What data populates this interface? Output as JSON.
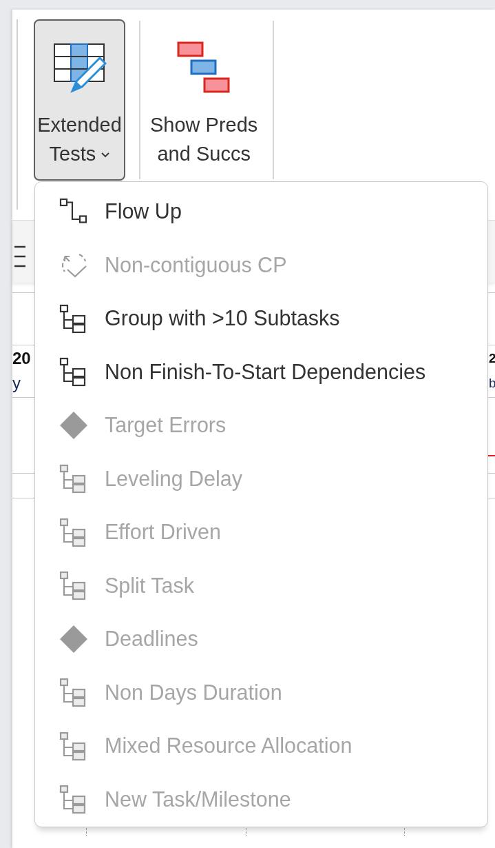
{
  "ribbon": {
    "buttons": [
      {
        "kind": "table-edit",
        "label_lines": [
          "Extended",
          "Tests"
        ],
        "dropdown": true,
        "selected": true
      },
      {
        "kind": "gantt",
        "label_lines": [
          "Show Preds",
          "and Succs"
        ],
        "dropdown": false,
        "selected": false
      }
    ]
  },
  "background": {
    "left_cells": [
      "20",
      "y"
    ],
    "right_cells": [
      "2",
      "b"
    ]
  },
  "menu": {
    "items": [
      {
        "label": "Flow Up",
        "kind": "flow",
        "disabled": false
      },
      {
        "label": "Non-contiguous CP",
        "kind": "dashed-check",
        "disabled": true
      },
      {
        "label": "Group with >10 Subtasks",
        "kind": "tree",
        "disabled": false
      },
      {
        "label": "Non Finish-To-Start Dependencies",
        "kind": "tree",
        "disabled": false
      },
      {
        "label": "Target Errors",
        "kind": "diamond",
        "disabled": true
      },
      {
        "label": "Leveling Delay",
        "kind": "tree",
        "disabled": true
      },
      {
        "label": "Effort Driven",
        "kind": "tree",
        "disabled": true
      },
      {
        "label": "Split Task",
        "kind": "tree",
        "disabled": true
      },
      {
        "label": "Deadlines",
        "kind": "diamond",
        "disabled": true
      },
      {
        "label": "Non Days Duration",
        "kind": "tree",
        "disabled": true
      },
      {
        "label": "Mixed Resource Allocation",
        "kind": "tree",
        "disabled": true
      },
      {
        "label": "New Task/Milestone",
        "kind": "tree",
        "disabled": true
      }
    ]
  }
}
